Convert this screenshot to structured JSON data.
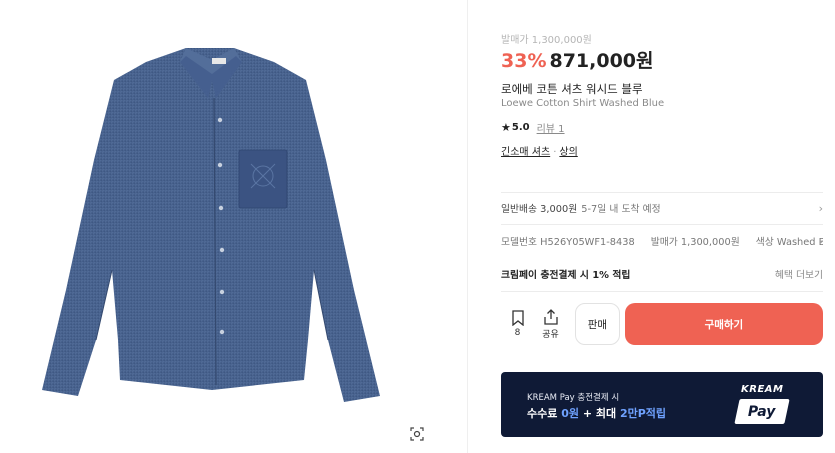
{
  "product": {
    "original_price": "발매가 1,300,000원",
    "discount": "33%",
    "price": "871,000원",
    "name_ko": "로에베 코튼 셔츠 워시드 블루",
    "name_en": "Loewe Cotton Shirt Washed Blue",
    "rating": "5.0",
    "review_link": "리뷰 1",
    "categories": [
      "긴소매 셔츠",
      "상의"
    ],
    "category_sep": "·"
  },
  "shipping": {
    "label": "일반배송 3,000원",
    "eta": "5-7일 내 도착 예정"
  },
  "specs": {
    "model": "모델번호 H526Y05WF1-8438",
    "release": "발매가 1,300,000원",
    "color": "색상 Washed Blue"
  },
  "payment_benefit": {
    "title": "크림페이 충전결제 시 1% 적립",
    "more": "혜택 더보기"
  },
  "actions": {
    "bookmark_count": "8",
    "share_label": "공유",
    "sell_label": "판매",
    "buy_label": "구매하기"
  },
  "banner": {
    "subtitle": "KREAM Pay 충전결제 시",
    "main_prefix": "수수료 ",
    "main_zero": "0원",
    "main_mid": " + 최대 ",
    "main_points": "2만P적립",
    "logo_top": "KREAM",
    "logo_bottom": "Pay"
  },
  "colors": {
    "accent": "#ef6253",
    "banner_bg": "#0f1a36",
    "shirt": "#3f5986"
  },
  "icons": [
    "lens-search-icon",
    "bookmark-icon",
    "share-icon",
    "chevron-right-icon",
    "star-icon"
  ]
}
